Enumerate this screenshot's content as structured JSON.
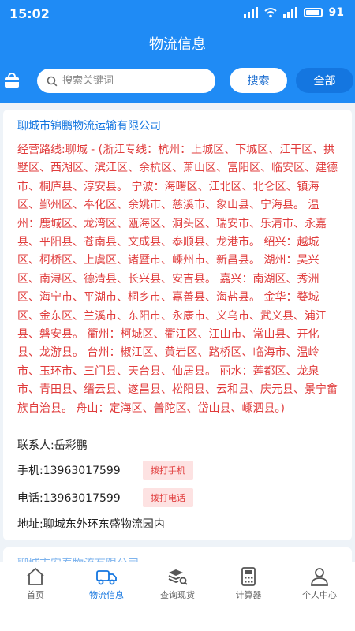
{
  "status": {
    "time": "15:02",
    "battery": "91"
  },
  "header": {
    "title": "物流信息"
  },
  "search": {
    "placeholder": "搜索关键词",
    "value": "",
    "search_label": "搜索",
    "all_label": "全部"
  },
  "listing": {
    "company": "聊城市锦鹏物流运输有限公司",
    "route": "经营路线:聊城 - (浙江专线：杭州：上城区、下城区、江干区、拱墅区、西湖区、滨江区、余杭区、萧山区、富阳区、临安区、建德市、桐庐县、淳安县。 宁波：海曙区、江北区、北仑区、镇海区、鄞州区、奉化区、余姚市、慈溪市、象山县、宁海县。 温州：鹿城区、龙湾区、瓯海区、洞头区、瑞安市、乐清市、永嘉县、平阳县、苍南县、文成县、泰顺县、龙港市。 绍兴：越城区、柯桥区、上虞区、诸暨市、嵊州市、新昌县。 湖州：吴兴区、南浔区、德清县、长兴县、安吉县。 嘉兴：南湖区、秀洲区、海宁市、平湖市、桐乡市、嘉善县、海盐县。 金华：婺城区、金东区、兰溪市、东阳市、永康市、义乌市、武义县、浦江县、磐安县。 衢州：柯城区、衢江区、江山市、常山县、开化县、龙游县。 台州：椒江区、黄岩区、路桥区、临海市、温岭市、玉环市、三门县、天台县、仙居县。 丽水：莲都区、龙泉市、青田县、缙云县、遂昌县、松阳县、云和县、庆元县、景宁畲族自治县。 舟山：定海区、普陀区、岱山县、嵊泗县。)",
    "contact": "联系人:岳彩鹏",
    "mobile": "手机:13963017599",
    "call_mobile_label": "拨打手机",
    "phone": "电话:13963017599",
    "call_phone_label": "拨打电话",
    "address": "地址:聊城东外环东盛物流园内"
  },
  "next_listing": {
    "company": "聊城市安泰物流有限公司"
  },
  "tabs": [
    {
      "label": "首页",
      "icon": "home-icon"
    },
    {
      "label": "物流信息",
      "icon": "truck-icon"
    },
    {
      "label": "查询现货",
      "icon": "stack-search-icon"
    },
    {
      "label": "计算器",
      "icon": "calculator-icon"
    },
    {
      "label": "个人中心",
      "icon": "person-icon"
    }
  ],
  "colors": {
    "primary": "#1f8bf5",
    "accent": "#1476e0",
    "route_text": "#e03c3c",
    "call_button_bg": "#fde2e2"
  }
}
